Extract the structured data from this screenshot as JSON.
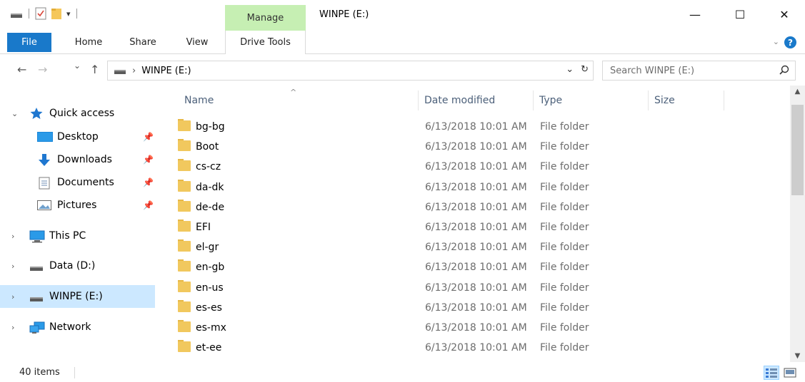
{
  "titlebar": {
    "manage_tab": "Manage",
    "title": "WINPE (E:)",
    "minimize": "—",
    "maximize": "☐",
    "close": "✕"
  },
  "ribbon": {
    "tabs": [
      {
        "label": "File",
        "active": true
      },
      {
        "label": "Home"
      },
      {
        "label": "Share"
      },
      {
        "label": "View"
      },
      {
        "label": "Drive Tools"
      }
    ],
    "expand_icon": "chevron-down-icon",
    "help": "?"
  },
  "nav": {
    "back": "←",
    "forward": "→",
    "recent": "⌄",
    "up": "↑"
  },
  "address": {
    "separator": "›",
    "path": "WINPE (E:)",
    "dropdown": "⌄",
    "refresh": "↻"
  },
  "search": {
    "placeholder": "Search WINPE (E:)",
    "icon": "⚲"
  },
  "sidebar": {
    "items": [
      {
        "label": "Quick access",
        "icon": "star-icon",
        "chevron": "⌄"
      },
      {
        "label": "Desktop",
        "icon": "desktop-icon",
        "pinned": true
      },
      {
        "label": "Downloads",
        "icon": "download-icon",
        "pinned": true
      },
      {
        "label": "Documents",
        "icon": "documents-icon",
        "pinned": true
      },
      {
        "label": "Pictures",
        "icon": "pictures-icon",
        "pinned": true
      },
      {
        "label": "This PC",
        "icon": "computer-icon",
        "chevron": "›"
      },
      {
        "label": "Data (D:)",
        "icon": "drive-icon",
        "chevron": "›"
      },
      {
        "label": "WINPE (E:)",
        "icon": "drive-icon",
        "chevron": "›",
        "selected": true
      },
      {
        "label": "Network",
        "icon": "network-icon",
        "chevron": "›"
      }
    ]
  },
  "columns": {
    "name": "Name",
    "date": "Date modified",
    "type": "Type",
    "size": "Size",
    "sort_indicator": "^"
  },
  "files": [
    {
      "name": "bg-bg",
      "date": "6/13/2018 10:01 AM",
      "type": "File folder"
    },
    {
      "name": "Boot",
      "date": "6/13/2018 10:01 AM",
      "type": "File folder"
    },
    {
      "name": "cs-cz",
      "date": "6/13/2018 10:01 AM",
      "type": "File folder"
    },
    {
      "name": "da-dk",
      "date": "6/13/2018 10:01 AM",
      "type": "File folder"
    },
    {
      "name": "de-de",
      "date": "6/13/2018 10:01 AM",
      "type": "File folder"
    },
    {
      "name": "EFI",
      "date": "6/13/2018 10:01 AM",
      "type": "File folder"
    },
    {
      "name": "el-gr",
      "date": "6/13/2018 10:01 AM",
      "type": "File folder"
    },
    {
      "name": "en-gb",
      "date": "6/13/2018 10:01 AM",
      "type": "File folder"
    },
    {
      "name": "en-us",
      "date": "6/13/2018 10:01 AM",
      "type": "File folder"
    },
    {
      "name": "es-es",
      "date": "6/13/2018 10:01 AM",
      "type": "File folder"
    },
    {
      "name": "es-mx",
      "date": "6/13/2018 10:01 AM",
      "type": "File folder"
    },
    {
      "name": "et-ee",
      "date": "6/13/2018 10:01 AM",
      "type": "File folder"
    }
  ],
  "status": {
    "item_count": "40 items"
  },
  "colors": {
    "accent": "#1979ca",
    "manage_tab": "#c6efb3",
    "selection": "#cce8ff",
    "folder": "#f1c85e"
  }
}
